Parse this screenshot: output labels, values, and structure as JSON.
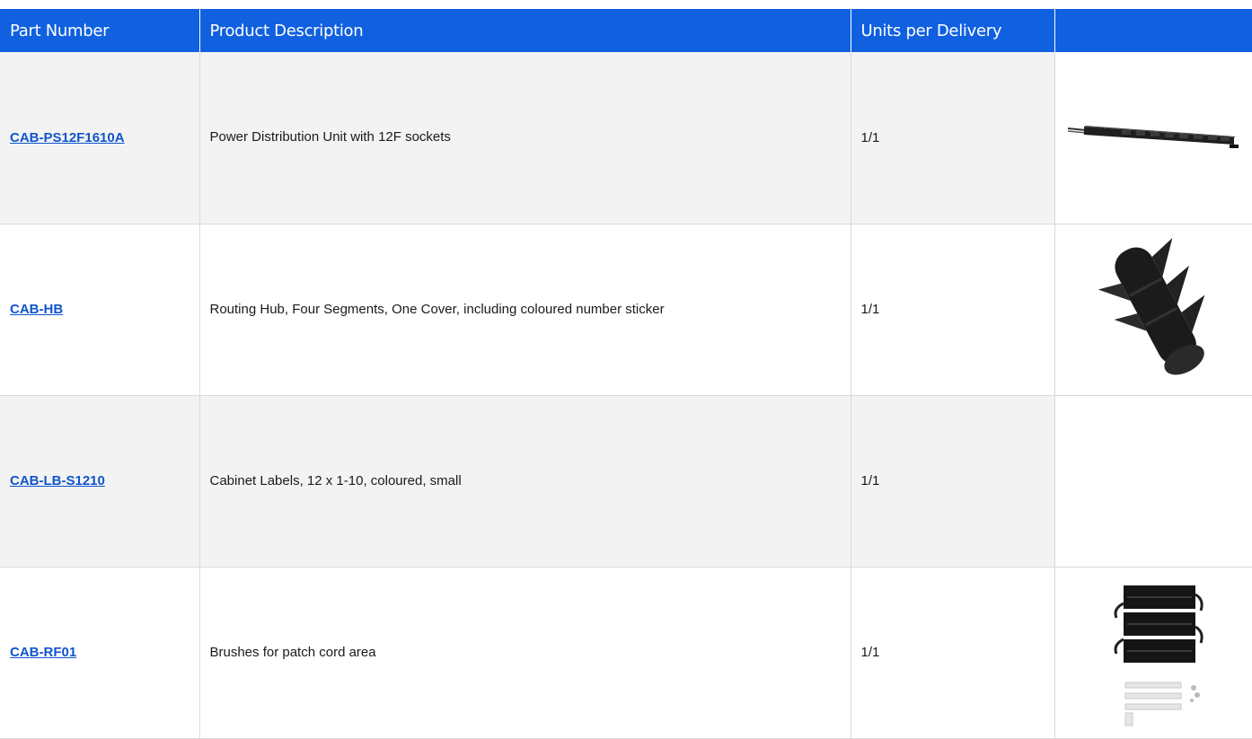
{
  "table": {
    "headers": {
      "part_number": "Part Number",
      "product_description": "Product Description",
      "units_per_delivery": "Units per Delivery",
      "image": ""
    },
    "rows": [
      {
        "part_number": "CAB-PS12F1610A",
        "description": "Power Distribution Unit with 12F sockets",
        "units": "1/1",
        "image_icon": "power-distribution-unit-image"
      },
      {
        "part_number": "CAB-HB",
        "description": "Routing Hub, Four Segments, One Cover, including coloured number sticker",
        "units": "1/1",
        "image_icon": "routing-hub-image"
      },
      {
        "part_number": "CAB-LB-S1210",
        "description": "Cabinet Labels, 12 x 1-10, coloured, small",
        "units": "1/1",
        "image_icon": ""
      },
      {
        "part_number": "CAB-RF01",
        "description": "Brushes for patch cord area",
        "units": "1/1",
        "image_icon": "patch-cord-brushes-image"
      }
    ]
  },
  "colors": {
    "header_bg": "#1060e0",
    "link": "#1155cc",
    "row_alt": "#f3f3f3"
  }
}
